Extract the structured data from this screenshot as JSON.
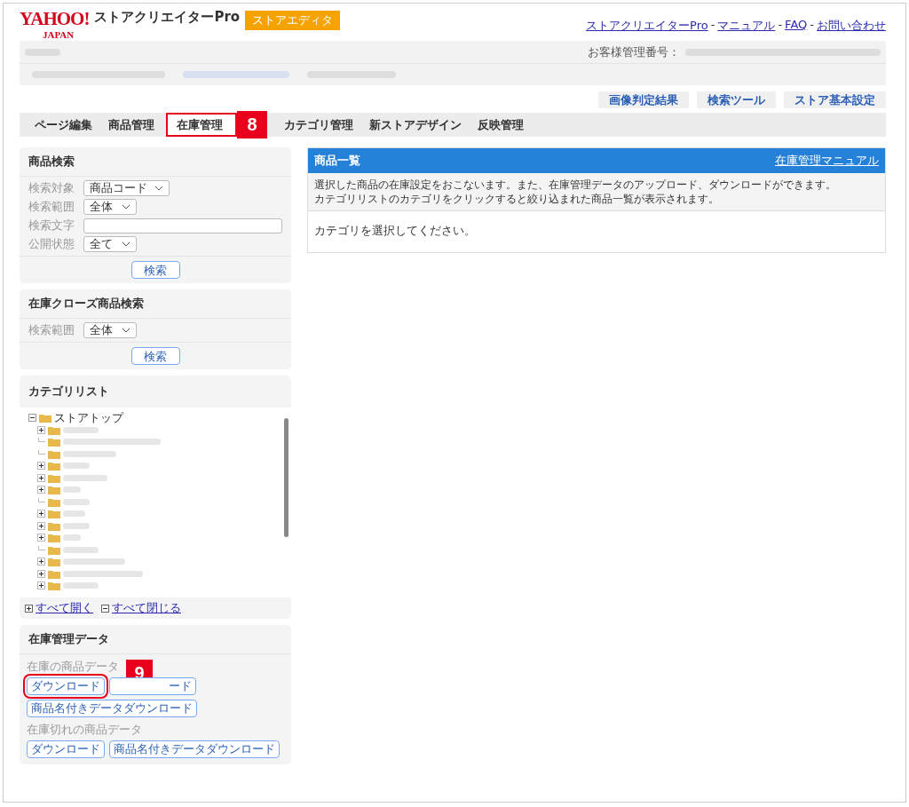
{
  "header": {
    "logo_main": "YAHOO!",
    "logo_sub": "JAPAN",
    "product": "ストアクリエイターPro",
    "badge": "ストアエディタ",
    "links": [
      "ストアクリエイターPro",
      "マニュアル",
      "FAQ",
      "お問い合わせ"
    ],
    "link_separator": "-",
    "customer_label": "お客様管理番号："
  },
  "tool_buttons": [
    "画像判定結果",
    "検索ツール",
    "ストア基本設定"
  ],
  "tabs": [
    {
      "label": "ページ編集",
      "selected": false
    },
    {
      "label": "商品管理",
      "selected": false
    },
    {
      "label": "在庫管理",
      "selected": true,
      "callout": "8"
    },
    {
      "label": "カテゴリ管理",
      "selected": false
    },
    {
      "label": "新ストアデザイン",
      "selected": false
    },
    {
      "label": "反映管理",
      "selected": false
    }
  ],
  "product_search": {
    "title": "商品検索",
    "fields": [
      {
        "label": "検索対象",
        "kind": "select",
        "value": "商品コード"
      },
      {
        "label": "検索範囲",
        "kind": "select",
        "value": "全体"
      },
      {
        "label": "検索文字",
        "kind": "text"
      },
      {
        "label": "公開状態",
        "kind": "select",
        "value": "全て"
      }
    ],
    "button": "検索"
  },
  "closed_search": {
    "title": "在庫クローズ商品検索",
    "fields": [
      {
        "label": "検索範囲",
        "kind": "select",
        "value": "全体"
      }
    ],
    "button": "検索"
  },
  "category_list": {
    "title": "カテゴリリスト",
    "root": "ストアトップ",
    "children": [
      {
        "expandable": true
      },
      {
        "expandable": false
      },
      {
        "expandable": false
      },
      {
        "expandable": true
      },
      {
        "expandable": true
      },
      {
        "expandable": true
      },
      {
        "expandable": false
      },
      {
        "expandable": true
      },
      {
        "expandable": true
      },
      {
        "expandable": true
      },
      {
        "expandable": false
      },
      {
        "expandable": true
      },
      {
        "expandable": true
      },
      {
        "expandable": true
      }
    ],
    "expand_all": "すべて開く",
    "collapse_all": "すべて閉じる"
  },
  "inventory_data": {
    "title": "在庫管理データ",
    "groups": [
      {
        "label": "在庫の商品データ",
        "buttons": [
          {
            "label": "ダウンロード",
            "callout": "9"
          },
          {
            "label": "ード"
          },
          {
            "label": "商品名付きデータダウンロード"
          }
        ]
      },
      {
        "label": "在庫切れの商品データ",
        "buttons": [
          {
            "label": "ダウンロード"
          },
          {
            "label": "商品名付きデータダウンロード"
          }
        ]
      }
    ]
  },
  "product_list": {
    "title": "商品一覧",
    "manual_link": "在庫管理マニュアル",
    "description": [
      "選択した商品の在庫設定をおこないます。また、在庫管理データのアップロード、ダウンロードができます。",
      "カテゴリリストのカテゴリをクリックすると絞り込まれた商品一覧が表示されます。"
    ],
    "message": "カテゴリを選択してください。"
  }
}
